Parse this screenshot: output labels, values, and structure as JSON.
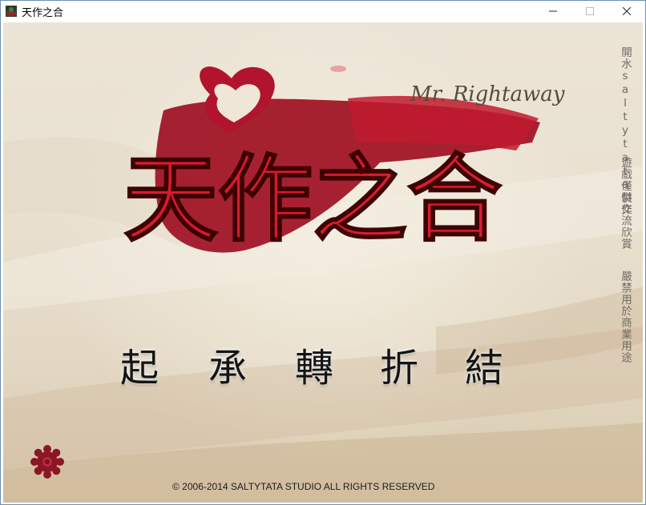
{
  "window": {
    "title": "天作之合"
  },
  "logo": {
    "title_text": "天作之合",
    "subtitle_text": "Mr. Rightaway",
    "accent_color": "#b8102a"
  },
  "menu": {
    "items": [
      {
        "label": "起"
      },
      {
        "label": "承"
      },
      {
        "label": "轉"
      },
      {
        "label": "折"
      },
      {
        "label": "結"
      }
    ]
  },
  "credits": {
    "line1": "開水saltytata製作",
    "line2": "遊戲僅供交流欣賞",
    "line3": "嚴禁用於商業用途"
  },
  "footer": {
    "copyright": "© 2006-2014 SALTYTATA STUDIO ALL RIGHTS RESERVED"
  },
  "icons": {
    "settings": "gear-icon"
  }
}
